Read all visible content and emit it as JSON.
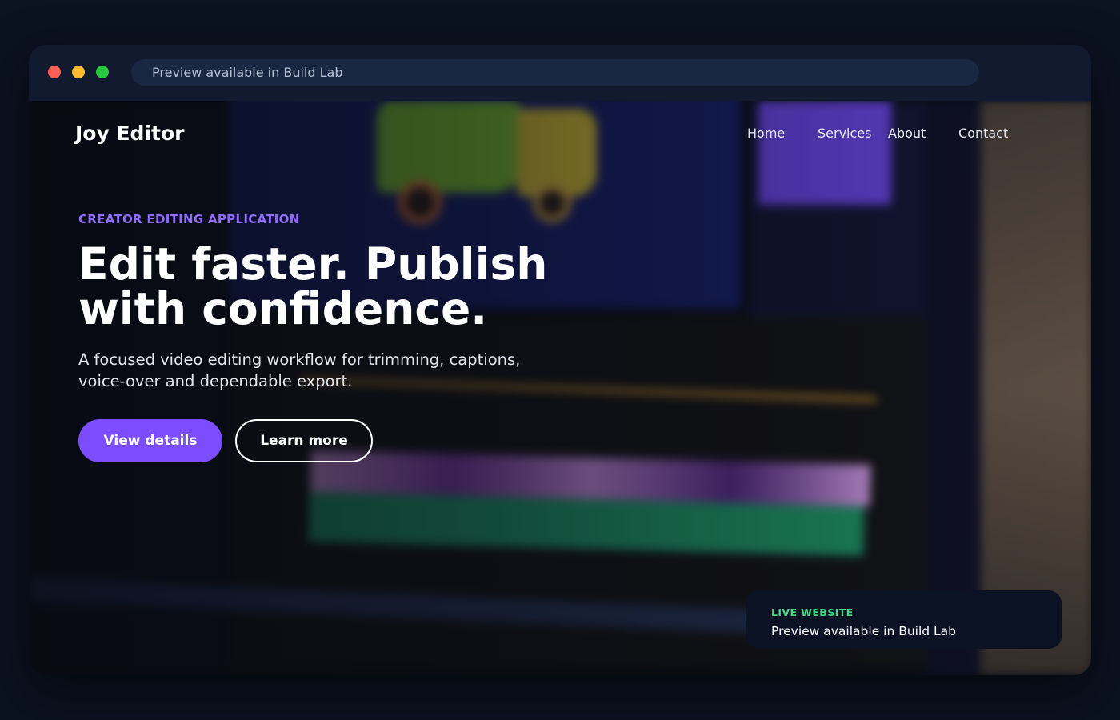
{
  "browser": {
    "address_text": "Preview available in Build Lab"
  },
  "site": {
    "brand": "Joy Editor",
    "nav": [
      {
        "label": "Home"
      },
      {
        "label": "Services"
      },
      {
        "label": "About"
      },
      {
        "label": "Contact"
      }
    ]
  },
  "hero": {
    "eyebrow": "CREATOR EDITING APPLICATION",
    "headline": "Edit faster. Publish with confidence.",
    "subtitle": "A focused video editing workflow for trimming, captions, voice-over and dependable export.",
    "primary_button": "View details",
    "secondary_button": "Learn more"
  },
  "status_card": {
    "label": "LIVE WEBSITE",
    "text": "Preview available in Build Lab"
  },
  "colors": {
    "accent": "#7c4dff",
    "eyebrow": "#8f6bff",
    "live_green": "#3ddc84"
  }
}
